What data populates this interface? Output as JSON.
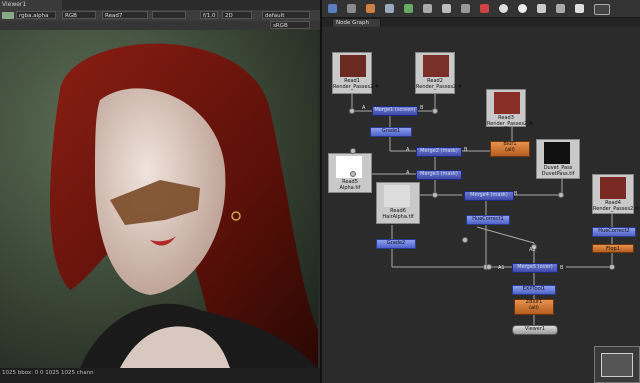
{
  "viewer": {
    "tab_label": "Viewer1",
    "channels": "rgba.alpha",
    "colorspace": "RGB",
    "input_a": "Read7",
    "gain": "f/1.0",
    "mode_2d": "2D",
    "lut": "default",
    "display": "sRGB",
    "status": "1025 bbox: 0 0 1025 1025 chann"
  },
  "node_graph": {
    "tab_label": "Node Graph",
    "toolbar_icons": [
      "merge-icon",
      "transform-icon",
      "color-icon",
      "filter-icon",
      "keyer-icon",
      "channel-icon",
      "draw-icon",
      "time-icon",
      "3d-icon",
      "views-icon",
      "metadata-icon",
      "toolsets-icon",
      "other-icon",
      "furnace-icon",
      "ocula-icon"
    ],
    "nodes": {
      "read1": {
        "title": "Read1",
        "file": "Render_Passes2.#"
      },
      "read2": {
        "title": "Read2",
        "file": "Render_Passes2.#"
      },
      "read3": {
        "title": "Read3",
        "file": "Render_Passes2.#"
      },
      "read4": {
        "title": "Read4",
        "file": "Render_Passes2.#"
      },
      "read5": {
        "title": "Read5",
        "file": "Alpha.tif"
      },
      "read6": {
        "title": "Read6",
        "file": "HairAlpha.tif"
      },
      "read7": {
        "title": "Duvet_Pass",
        "file": "DuvetPass.tif"
      },
      "merge_screen": "Merge1 (screen)",
      "grade1": "Grade1",
      "blur1_title": "Blur1",
      "blur1_sub": "(all)",
      "merge_mask1": "Merge2 (mask)",
      "merge_mask2": "Merge3 (mask)",
      "merge_mask3": "Merge4 (mask)",
      "huecorrect1": "HueCorrect1",
      "huecorrect2": "HueCorrect2",
      "grade2": "Grade2",
      "flop1": "Flop1",
      "merge_over": "Merge5 (over)",
      "exptool": "EXPTool1",
      "zblur_title": "ZBlur1",
      "zblur_sub": "(all)",
      "viewer1": "Viewer1"
    },
    "pins": {
      "a": "A",
      "b": "B",
      "a2": "A2",
      "a1": "A1"
    }
  }
}
